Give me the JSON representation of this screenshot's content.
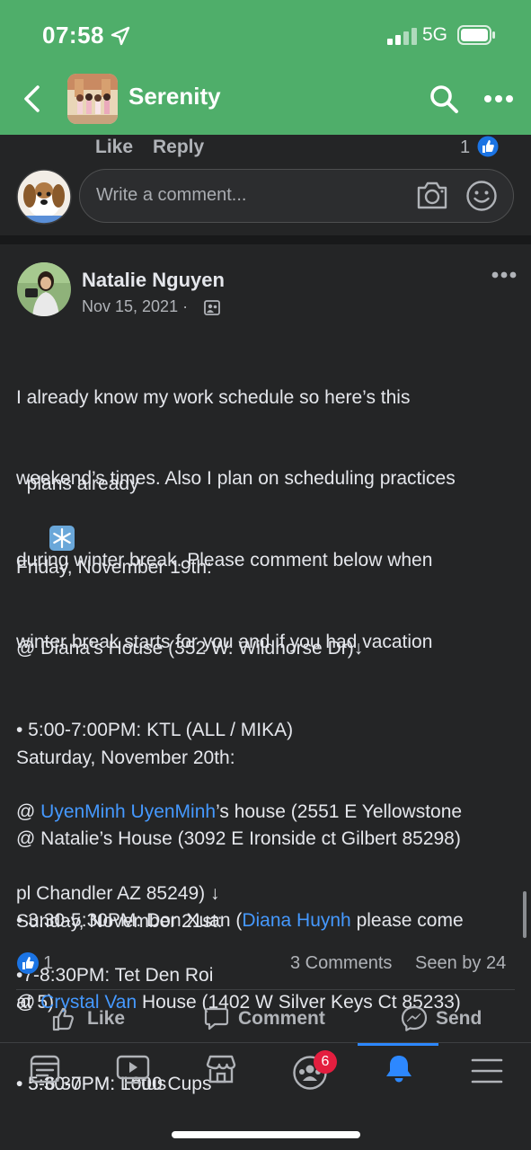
{
  "status_bar": {
    "time": "07:58",
    "network": "5G"
  },
  "header": {
    "title": "Serenity"
  },
  "previous_comment": {
    "like_label": "Like",
    "reply_label": "Reply",
    "reaction_count": "1"
  },
  "comment_input": {
    "placeholder": "Write a comment..."
  },
  "post": {
    "author": "Natalie Nguyen",
    "date": "Nov 15, 2021 ·",
    "lines": [
      "I already know my work schedule so here’s this",
      "weekend’s times. Also I plan on scheduling practices",
      "during winter break. Please comment below when",
      "winter break starts for you and if you had vacation"
    ],
    "line_last": "plans already",
    "snowflake": "❄️",
    "friday": {
      "heading": "Friday, November 19th:",
      "loc1": "@ Diana’s House (352 W. Wildhorse Dr)↓",
      "item1": "• 5:00-7:00PM: KTL (ALL / MIKA)",
      "loc2_prefix": "@ ",
      "loc2_link": "UyenMinh UyenMinh",
      "loc2_suffix": "’s house (2551 E Yellowstone",
      "loc2_line2": "pl Chandler AZ 85249) ↓",
      "item2": "•7-8:30PM: Tet Den Roi"
    },
    "saturday": {
      "heading": "Saturday, November 20th:",
      "loc": "@ Natalie’s House (3092 E Ironside ct Gilbert 85298)",
      "item1_prefix": "• 3:30-5:30PM: Don Xuan (",
      "item1_link": "Diana Huynh",
      "item1_suffix": " please come",
      "item1_line2": "at 5)",
      "item2": "• 5:30-7PM: 1000 Cups"
    },
    "sunday": {
      "heading": "Sunday, November 21st:",
      "loc_prefix": "@ ",
      "loc_link": "Crystal Van",
      "loc_suffix": " House (1402 W Silver Keys Ct 85233)",
      "item": "• 5-6:30PM: Lotus"
    },
    "reaction_count": "1",
    "comments_count": "3 Comments",
    "seen_by": "Seen by 24",
    "actions": {
      "like": "Like",
      "comment": "Comment",
      "send": "Send"
    }
  },
  "bottom_nav": {
    "notifications_badge": "6"
  },
  "colors": {
    "header_green": "#4fae6a",
    "background": "#242526",
    "link_blue": "#4599ff",
    "like_blue": "#1b74e4",
    "badge_red": "#e41e3f"
  }
}
